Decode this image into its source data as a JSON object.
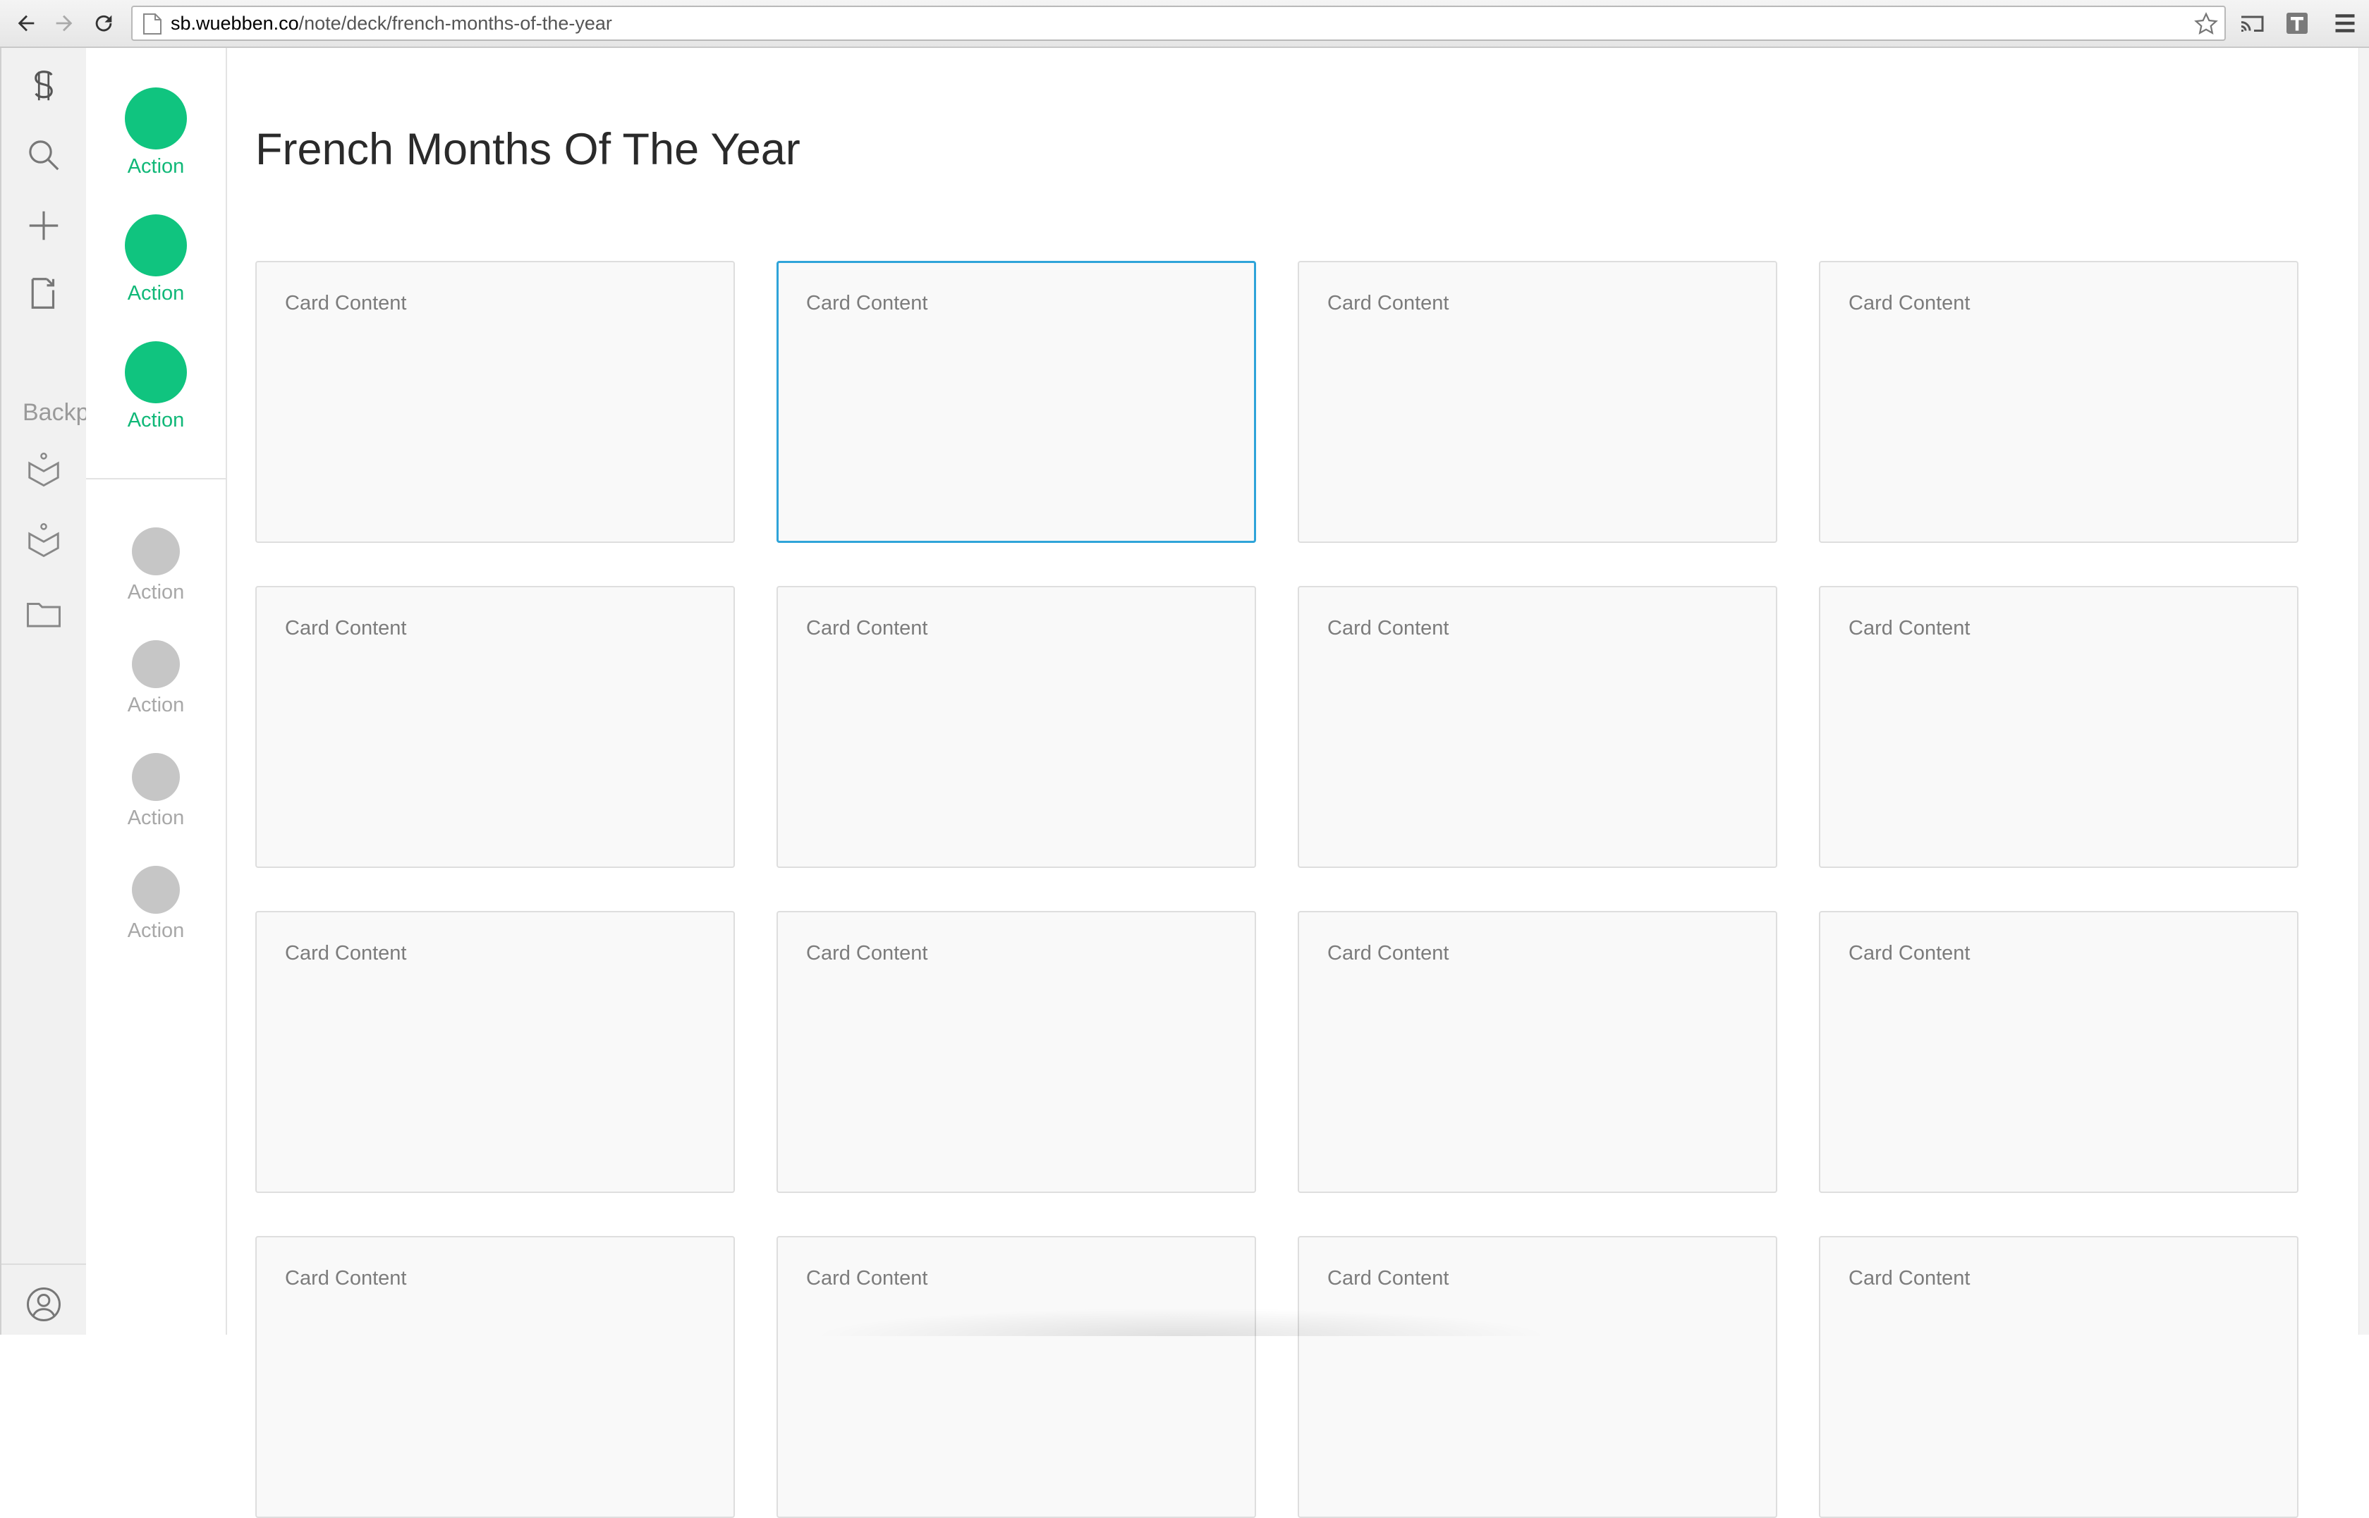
{
  "browser": {
    "url_domain": "sb.wuebben.co",
    "url_path": "/note/deck/french-months-of-the-year"
  },
  "rail": {
    "icons": [
      "logo-icon",
      "search-icon",
      "plus-icon",
      "document-export-icon",
      "backpack-icon",
      "backpack-icon",
      "folder-icon",
      "user-profile-icon"
    ],
    "label": "Backp"
  },
  "actions": {
    "primary": [
      {
        "label": "Action"
      },
      {
        "label": "Action"
      },
      {
        "label": "Action"
      }
    ],
    "secondary": [
      {
        "label": "Action"
      },
      {
        "label": "Action"
      },
      {
        "label": "Action"
      },
      {
        "label": "Action"
      }
    ],
    "primary_color": "#10c47f",
    "secondary_color": "#c6c6c6"
  },
  "page": {
    "title": "French Months Of The Year"
  },
  "cards": [
    {
      "text": "Card Content"
    },
    {
      "text": "Card Content",
      "selected": true
    },
    {
      "text": "Card Content"
    },
    {
      "text": "Card Content"
    },
    {
      "text": "Card Content"
    },
    {
      "text": "Card Content"
    },
    {
      "text": "Card Content"
    },
    {
      "text": "Card Content"
    },
    {
      "text": "Card Content"
    },
    {
      "text": "Card Content"
    },
    {
      "text": "Card Content"
    },
    {
      "text": "Card Content"
    },
    {
      "text": "Card Content"
    },
    {
      "text": "Card Content"
    },
    {
      "text": "Card Content"
    },
    {
      "text": "Card Content"
    }
  ],
  "selected_border_color": "#2fa4d9"
}
